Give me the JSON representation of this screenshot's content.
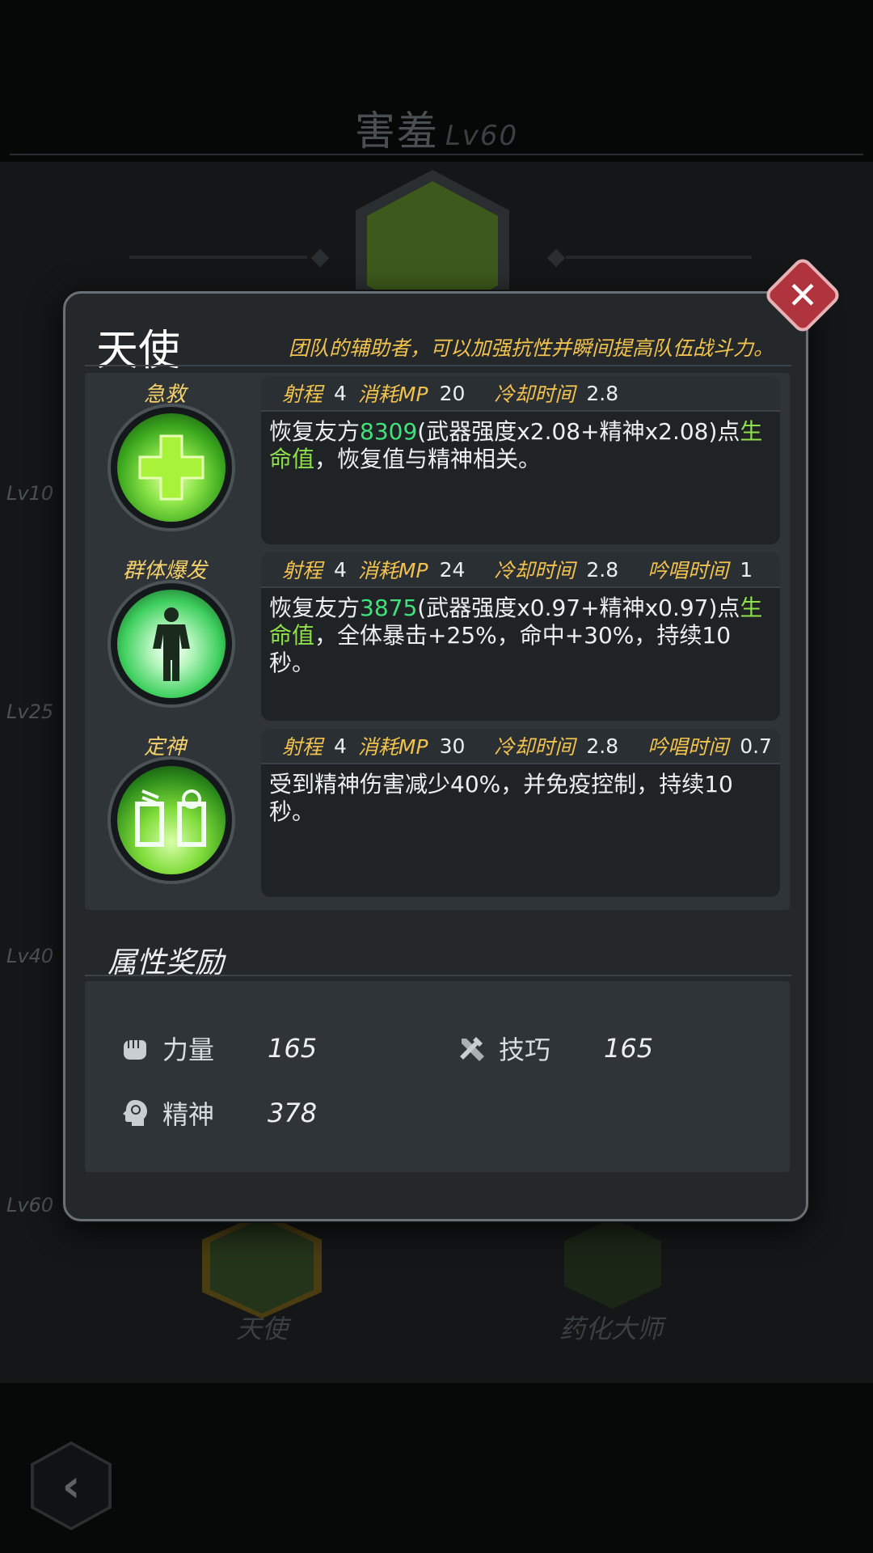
{
  "background": {
    "character_name": "害羞",
    "character_level": "Lv60",
    "side_levels": [
      "Lv10",
      "Lv25",
      "Lv40",
      "Lv60"
    ],
    "classes": [
      {
        "label": "天使"
      },
      {
        "label": "药化大师"
      }
    ]
  },
  "modal": {
    "title": "天使",
    "description": "团队的辅助者，可以加强抗性并瞬间提高队伍战斗力。",
    "skills": [
      {
        "name": "急救",
        "icon": "cross-heal-icon",
        "range_label": "射程",
        "range": "4",
        "mp_label": "消耗MP",
        "mp": "20",
        "cooldown_label": "冷却时间",
        "cooldown": "2.8",
        "text_a": "恢复友方",
        "num": "8309",
        "text_b": "(武器强度x2.08+精神x2.08)点",
        "word": "生命值",
        "text_c": "，恢复值与精神相关。"
      },
      {
        "name": "群体爆发",
        "icon": "group-burst-icon",
        "range_label": "射程",
        "range": "4",
        "mp_label": "消耗MP",
        "mp": "24",
        "cooldown_label": "冷却时间",
        "cooldown": "2.8",
        "cast_label": "吟唱时间",
        "cast": "1",
        "text_a": "恢复友方",
        "num": "3875",
        "text_b": "(武器强度x0.97+精神x0.97)点",
        "word": "生命值",
        "text_c": "，全体暴击+25%，命中+30%，持续10秒。"
      },
      {
        "name": "定神",
        "icon": "calm-mind-icon",
        "range_label": "射程",
        "range": "4",
        "mp_label": "消耗MP",
        "mp": "30",
        "cooldown_label": "冷却时间",
        "cooldown": "2.8",
        "cast_label": "吟唱时间",
        "cast": "0.7",
        "text_plain": "受到精神伤害减少40%，并免疫控制，持续10秒。"
      }
    ],
    "attributes_title": "属性奖励",
    "attributes": [
      {
        "label": "力量",
        "value": "165",
        "icon": "fist-icon"
      },
      {
        "label": "技巧",
        "value": "165",
        "icon": "tools-icon"
      },
      {
        "label": "精神",
        "value": "378",
        "icon": "head-mind-icon"
      }
    ]
  },
  "colors": {
    "accent_gold": "#f2c24e",
    "heal_green": "#3fe27b",
    "hp_green": "#8fe04a",
    "close_red": "#b0343d"
  }
}
